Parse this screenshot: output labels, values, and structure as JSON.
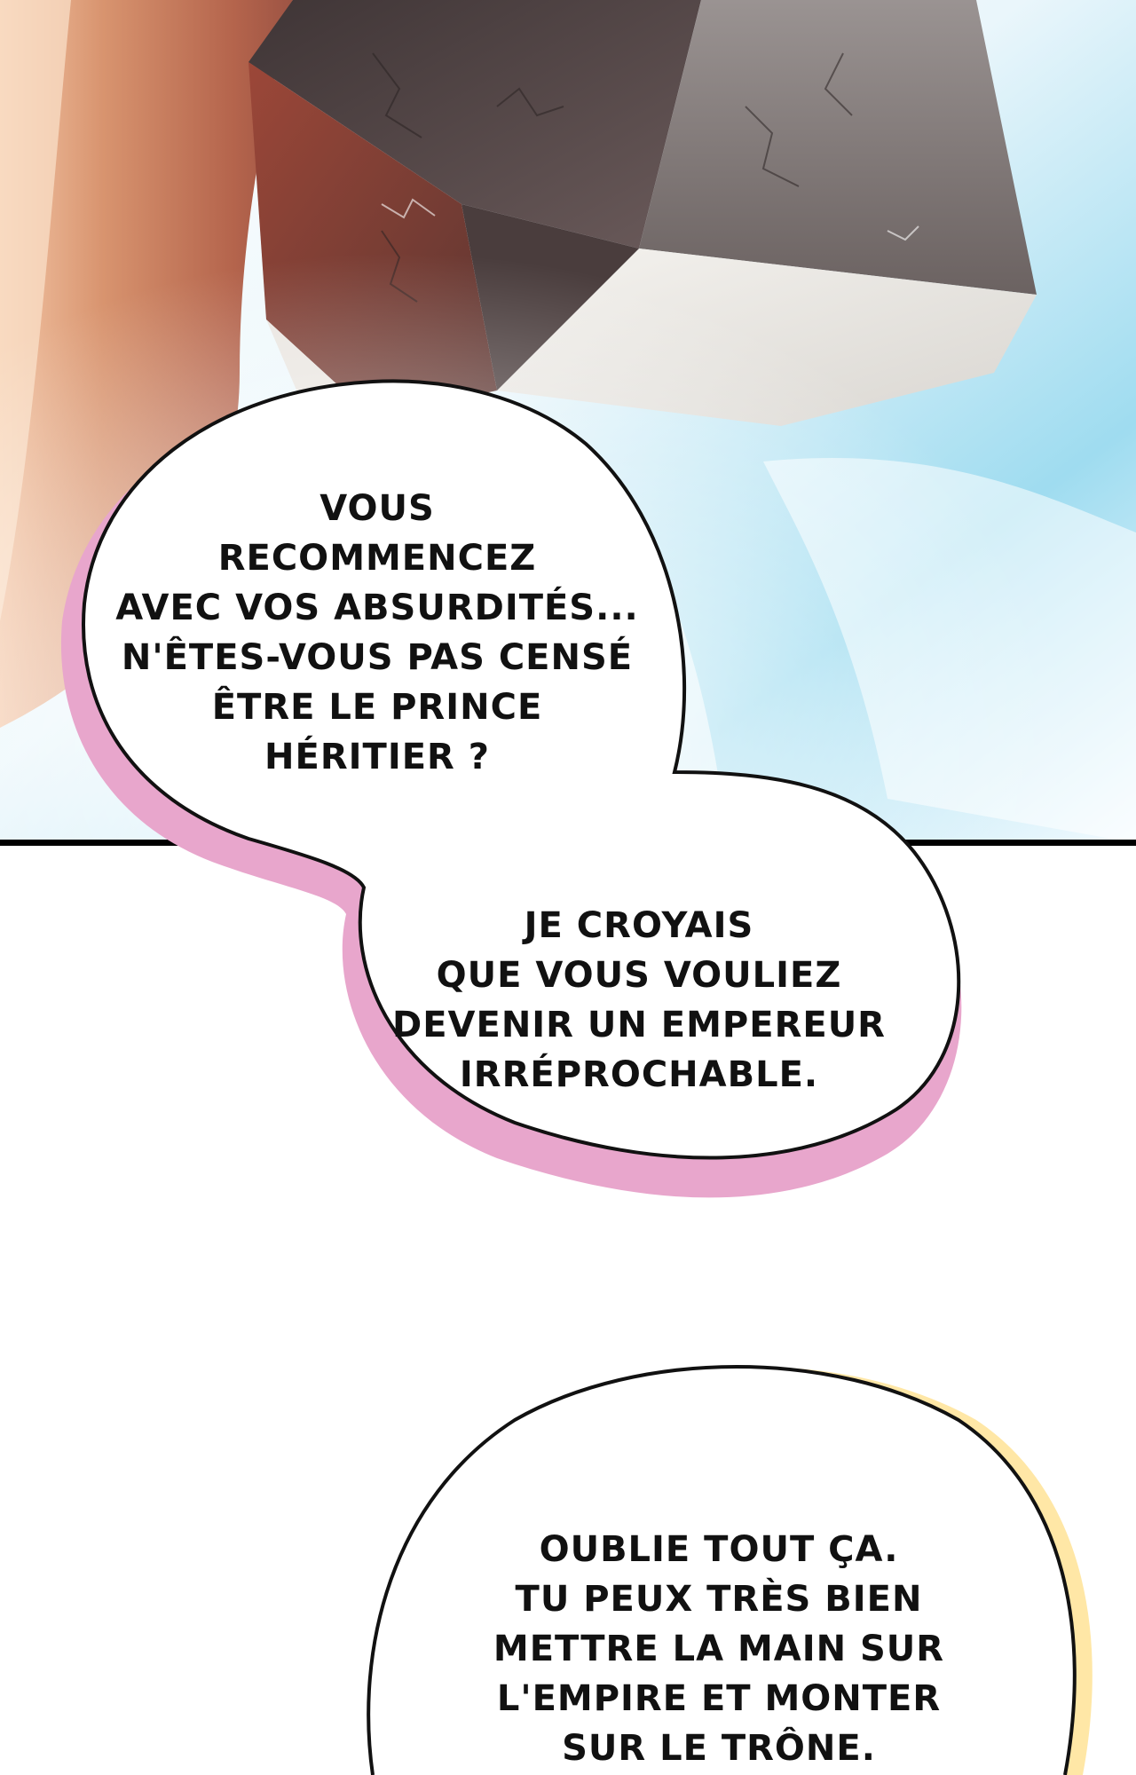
{
  "bubbles": [
    {
      "lines": [
        "VOUS",
        "RECOMMENCEZ",
        "AVEC VOS ABSURDITÉS...",
        "N'ÊTES-VOUS PAS CENSÉ",
        "ÊTRE LE PRINCE",
        "HÉRITIER ?"
      ]
    },
    {
      "lines": [
        "JE CROYAIS",
        "QUE VOUS VOULIEZ",
        "DEVENIR UN EMPEREUR",
        "IRRÉPROCHABLE."
      ]
    },
    {
      "lines": [
        "OUBLIE TOUT ÇA.",
        "TU PEUX TRÈS BIEN",
        "METTRE LA MAIN SUR",
        "L'EMPIRE ET MONTER",
        "SUR LE TRÔNE."
      ]
    }
  ],
  "colors": {
    "bubble_shadow_pink": "#e8a6cc",
    "bubble_shadow_yellow": "#ffe7a6",
    "sky": "#bfe6f5",
    "crystal_dark": "#6a5552",
    "crystal_light": "#ece9e4",
    "hair": "#c98261"
  }
}
